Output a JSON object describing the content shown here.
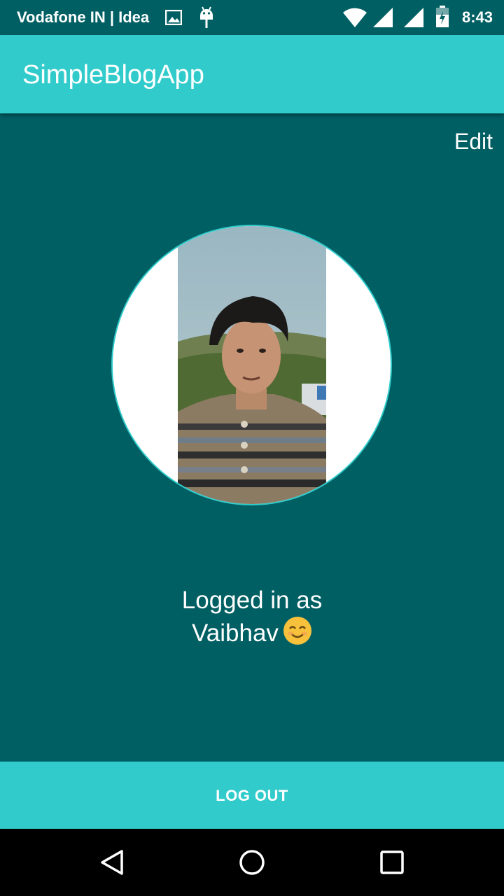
{
  "status_bar": {
    "carrier": "Vodafone IN | Idea",
    "time": "8:43",
    "icons": [
      "image-icon",
      "android-debug-icon",
      "wifi-icon",
      "signal-icon",
      "signal-icon",
      "battery-charging-icon"
    ]
  },
  "app_bar": {
    "title": "SimpleBlogApp"
  },
  "profile": {
    "edit_label": "Edit",
    "logged_in_line1": "Logged in as",
    "logged_in_line2": "Vaibhav"
  },
  "logout_label": "LOG OUT",
  "nav_bar": {
    "icons": [
      "back-icon",
      "home-icon",
      "recents-icon"
    ]
  },
  "colors": {
    "primary": "#31cbcb",
    "background": "#005f63",
    "nav": "#000000"
  }
}
